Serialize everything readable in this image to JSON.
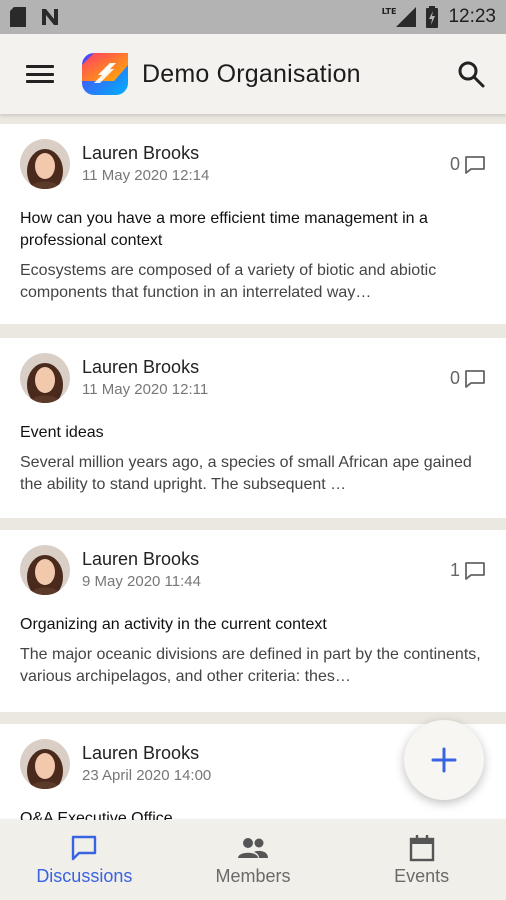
{
  "status_bar": {
    "network": "LTE",
    "time": "12:23"
  },
  "app_bar": {
    "title": "Demo Organisation"
  },
  "posts": [
    {
      "author": "Lauren Brooks",
      "date": "11 May 2020 12:14",
      "comments": "0",
      "title": "How can you have a more efficient time management in a professional context",
      "excerpt": "Ecosystems are composed of a variety of biotic and abiotic components that function in an interrelated way…"
    },
    {
      "author": "Lauren Brooks",
      "date": "11 May 2020 12:11",
      "comments": "0",
      "title": "Event ideas",
      "excerpt": "Several million years ago, a species of small African ape gained the ability to stand upright. The subsequent …"
    },
    {
      "author": "Lauren Brooks",
      "date": "9 May 2020 11:44",
      "comments": "1",
      "title": "Organizing an activity in the current context",
      "excerpt": "The major oceanic divisions are defined in part by the continents, various archipelagos, and other criteria: thes…"
    },
    {
      "author": "Lauren Brooks",
      "date": "23 April 2020 14:00",
      "comments": "",
      "title": "Q&A Executive Office",
      "excerpt": ""
    }
  ],
  "bottom_nav": [
    {
      "label": "Discussions",
      "icon": "chat-icon",
      "active": true
    },
    {
      "label": "Members",
      "icon": "people-icon",
      "active": false
    },
    {
      "label": "Events",
      "icon": "calendar-icon",
      "active": false
    }
  ],
  "colors": {
    "accent": "#3a63e0",
    "background": "#ebe8e1",
    "card": "#ffffff"
  }
}
